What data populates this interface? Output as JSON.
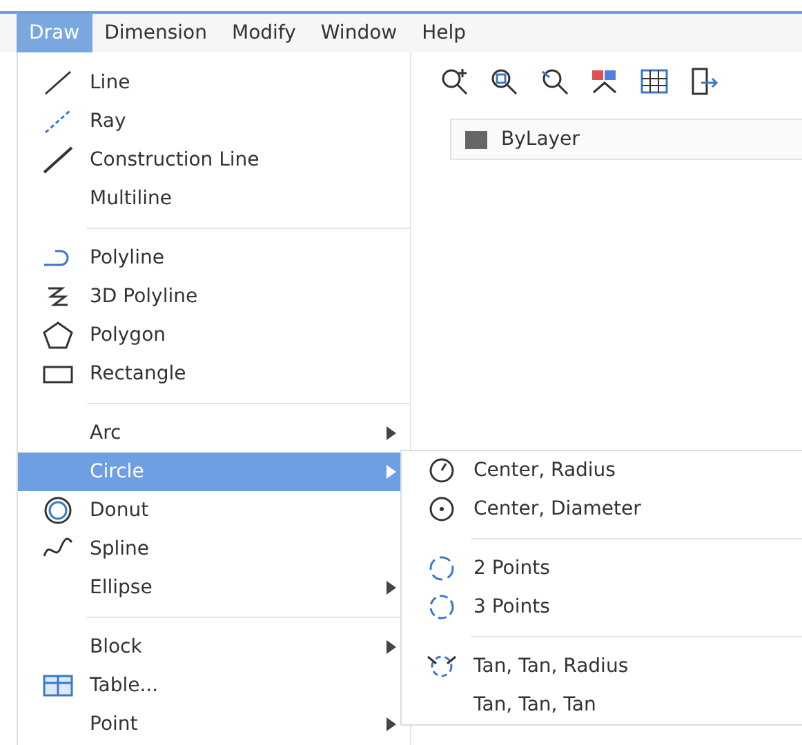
{
  "menubar": [
    {
      "label": "Draw",
      "selected": true
    },
    {
      "label": "Dimension",
      "selected": false
    },
    {
      "label": "Modify",
      "selected": false
    },
    {
      "label": "Window",
      "selected": false
    },
    {
      "label": "Help",
      "selected": false
    }
  ],
  "toolbar": {
    "layer_field": {
      "value": "ByLayer"
    }
  },
  "menu": [
    {
      "kind": "item",
      "label": "Line",
      "selected": false,
      "submenu": false
    },
    {
      "kind": "item",
      "label": "Ray",
      "selected": false,
      "submenu": false
    },
    {
      "kind": "item",
      "label": "Construction Line",
      "selected": false,
      "submenu": false
    },
    {
      "kind": "item",
      "label": "Multiline",
      "selected": false,
      "submenu": false
    },
    {
      "kind": "separator"
    },
    {
      "kind": "item",
      "label": "Polyline",
      "selected": false,
      "submenu": false
    },
    {
      "kind": "item",
      "label": "3D Polyline",
      "selected": false,
      "submenu": false
    },
    {
      "kind": "item",
      "label": "Polygon",
      "selected": false,
      "submenu": false
    },
    {
      "kind": "item",
      "label": "Rectangle",
      "selected": false,
      "submenu": false
    },
    {
      "kind": "separator"
    },
    {
      "kind": "item",
      "label": "Arc",
      "selected": false,
      "submenu": true
    },
    {
      "kind": "item",
      "label": "Circle",
      "selected": true,
      "submenu": true
    },
    {
      "kind": "item",
      "label": "Donut",
      "selected": false,
      "submenu": false
    },
    {
      "kind": "item",
      "label": "Spline",
      "selected": false,
      "submenu": false
    },
    {
      "kind": "item",
      "label": "Ellipse",
      "selected": false,
      "submenu": true
    },
    {
      "kind": "separator"
    },
    {
      "kind": "item",
      "label": "Block",
      "selected": false,
      "submenu": true
    },
    {
      "kind": "item",
      "label": "Table...",
      "selected": false,
      "submenu": false
    },
    {
      "kind": "item",
      "label": "Point",
      "selected": false,
      "submenu": true
    }
  ],
  "submenu": [
    {
      "kind": "item",
      "label": "Center, Radius"
    },
    {
      "kind": "item",
      "label": "Center, Diameter"
    },
    {
      "kind": "separator"
    },
    {
      "kind": "item",
      "label": "2 Points"
    },
    {
      "kind": "item",
      "label": "3 Points"
    },
    {
      "kind": "separator"
    },
    {
      "kind": "item",
      "label": "Tan, Tan, Radius"
    },
    {
      "kind": "item",
      "label": "Tan, Tan, Tan"
    }
  ]
}
